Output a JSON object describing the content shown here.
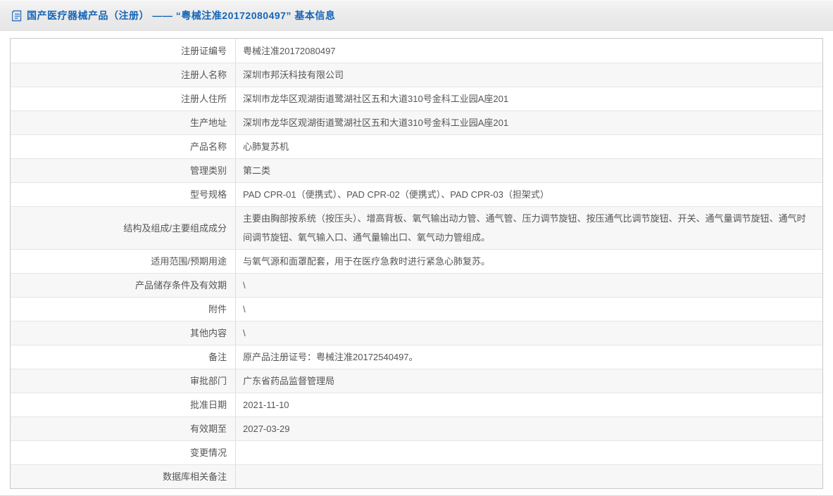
{
  "colors": {
    "accent_blue": "#1565b8",
    "row_stripe": "#f7f7f7",
    "table_border": "#c9c9c9",
    "header_bg": "#eaeaea",
    "text": "#555555"
  },
  "header": {
    "icon": "document-icon",
    "title": "国产医疗器械产品（注册） —— “粤械注准20172080497” 基本信息"
  },
  "table": {
    "rows": [
      {
        "label": "注册证编号",
        "value": "粤械注准20172080497"
      },
      {
        "label": "注册人名称",
        "value": "深圳市邦沃科技有限公司"
      },
      {
        "label": "注册人住所",
        "value": "深圳市龙华区观湖街道鹭湖社区五和大道310号金科工业园A座201"
      },
      {
        "label": "生产地址",
        "value": "深圳市龙华区观湖街道鹭湖社区五和大道310号金科工业园A座201"
      },
      {
        "label": "产品名称",
        "value": "心肺复苏机"
      },
      {
        "label": "管理类别",
        "value": "第二类"
      },
      {
        "label": "型号规格",
        "value": "PAD CPR-01（便携式）、PAD CPR-02（便携式）、PAD CPR-03（担架式）"
      },
      {
        "label": "结构及组成/主要组成成分",
        "value": "主要由胸部按系统（按压头）、增高背板、氧气输出动力管、通气管、压力调节旋钮、按压通气比调节旋钮、开关、通气量调节旋钮、通气时间调节旋钮、氧气输入口、通气量输出口、氧气动力管组成。"
      },
      {
        "label": "适用范围/预期用途",
        "value": "与氧气源和面罩配套，用于在医疗急救时进行紧急心肺复苏。"
      },
      {
        "label": "产品储存条件及有效期",
        "value": "\\"
      },
      {
        "label": "附件",
        "value": "\\"
      },
      {
        "label": "其他内容",
        "value": "\\"
      },
      {
        "label": "备注",
        "value": "原产品注册证号：粤械注准20172540497。"
      },
      {
        "label": "审批部门",
        "value": "广东省药品监督管理局"
      },
      {
        "label": "批准日期",
        "value": "2021-11-10"
      },
      {
        "label": "有效期至",
        "value": "2027-03-29"
      },
      {
        "label": "变更情况",
        "value": ""
      },
      {
        "label": "数据库相关备注",
        "value": ""
      }
    ]
  }
}
